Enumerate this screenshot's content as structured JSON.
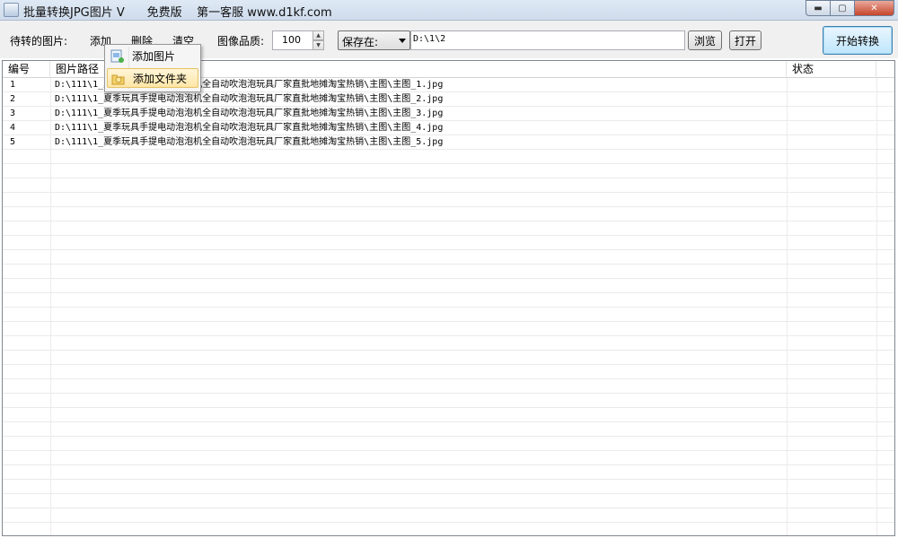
{
  "window": {
    "title": "批量转换JPG图片 V      免费版    第一客服 www.d1kf.com",
    "buttons": [
      "minimize-icon",
      "maximize-icon",
      "close-icon"
    ]
  },
  "toolbar": {
    "pending_label": "待转的图片:",
    "add_label": "添加",
    "delete_label": "删除",
    "clear_label": "清空",
    "quality_label": "图像品质:",
    "quality_value": "100",
    "save_select": "保存在:",
    "save_path": "D:\\1\\2",
    "browse_label": "浏览",
    "open_label": "打开",
    "start_label": "开始转换"
  },
  "table": {
    "headers": {
      "index": "编号",
      "path": "图片路径",
      "status": "状态"
    },
    "rows": [
      {
        "index": "1",
        "path": "D:\\111\\1_夏季玩具手提电动泡泡机全自动吹泡泡玩具厂家直批地摊淘宝热销\\主图\\主图_1.jpg",
        "status": ""
      },
      {
        "index": "2",
        "path": "D:\\111\\1_夏季玩具手提电动泡泡机全自动吹泡泡玩具厂家直批地摊淘宝热销\\主图\\主图_2.jpg",
        "status": ""
      },
      {
        "index": "3",
        "path": "D:\\111\\1_夏季玩具手提电动泡泡机全自动吹泡泡玩具厂家直批地摊淘宝热销\\主图\\主图_3.jpg",
        "status": ""
      },
      {
        "index": "4",
        "path": "D:\\111\\1_夏季玩具手提电动泡泡机全自动吹泡泡玩具厂家直批地摊淘宝热销\\主图\\主图_4.jpg",
        "status": ""
      },
      {
        "index": "5",
        "path": "D:\\111\\1_夏季玩具手提电动泡泡机全自动吹泡泡玩具厂家直批地摊淘宝热销\\主图\\主图_5.jpg",
        "status": ""
      }
    ]
  },
  "context_menu": {
    "items": [
      {
        "label": "添加图片",
        "icon": "add-image-icon"
      },
      {
        "label": "添加文件夹",
        "icon": "add-folder-icon"
      }
    ]
  },
  "colors": {
    "menu_highlight": "#ffe6a6",
    "primary_button": "#bee6fd"
  }
}
